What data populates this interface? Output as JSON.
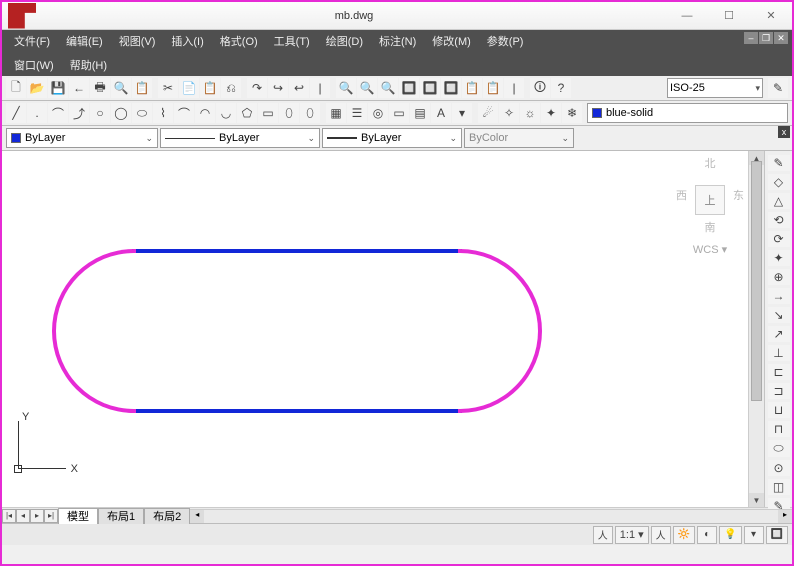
{
  "title": "mb.dwg",
  "win": {
    "min": "—",
    "max": "☐",
    "close": "✕"
  },
  "menus": [
    "文件(F)",
    "编辑(E)",
    "视图(V)",
    "插入(I)",
    "格式(O)",
    "工具(T)",
    "绘图(D)",
    "标注(N)",
    "修改(M)",
    "参数(P)",
    "窗口(W)",
    "帮助(H)"
  ],
  "dimstyle": "ISO-25",
  "layer_props": {
    "layer_name": "blue-solid"
  },
  "props": {
    "color": "ByLayer",
    "ltype": "ByLayer",
    "lweight": "ByLayer",
    "plotstyle": "ByColor"
  },
  "viewcube": {
    "n": "北",
    "s": "南",
    "w": "西",
    "e": "东",
    "top": "上",
    "wcs": "WCS ▾"
  },
  "tabs": {
    "model": "模型",
    "layout1": "布局1",
    "layout2": "布局2"
  },
  "status": {
    "scale": "1:1 ▾"
  },
  "ucs": {
    "x": "X",
    "y": "Y"
  },
  "icons": {
    "std": [
      "🗋",
      "📂",
      "💾",
      "←",
      "🖶",
      "🔍",
      "📋",
      "✂",
      "📄",
      "📋",
      "⎌",
      "↷",
      "↪",
      "↩",
      "|",
      "🖊",
      "🔍",
      "🔍",
      "🔍",
      "🔲",
      "🔲",
      "🔲",
      "📋",
      "📋",
      "|",
      "🛈",
      "?"
    ],
    "draw": [
      "╱",
      ".",
      "⌒",
      "⤴",
      "○",
      "◯",
      "⬭",
      "⌇",
      "⌒",
      "◠",
      "◡",
      "⬠",
      "▭",
      "⬯",
      "⬯",
      "|",
      "▦",
      "☰",
      "◎",
      "▭",
      "▤",
      "A",
      "▾"
    ],
    "mod": [
      "✧",
      "☼",
      "✦",
      "❄",
      "☐"
    ],
    "right": [
      "✎",
      "◇",
      "△",
      "⟲",
      "⟳",
      "✦",
      "⊕",
      "→",
      "↘",
      "↗",
      "⊥",
      "⊏",
      "⊐",
      "⊔",
      "⊓",
      "⬭",
      "⊙",
      "◫",
      "✎"
    ],
    "status": [
      "人",
      "人",
      "🔆",
      "◐",
      "💡",
      "▾",
      "🔲"
    ]
  }
}
